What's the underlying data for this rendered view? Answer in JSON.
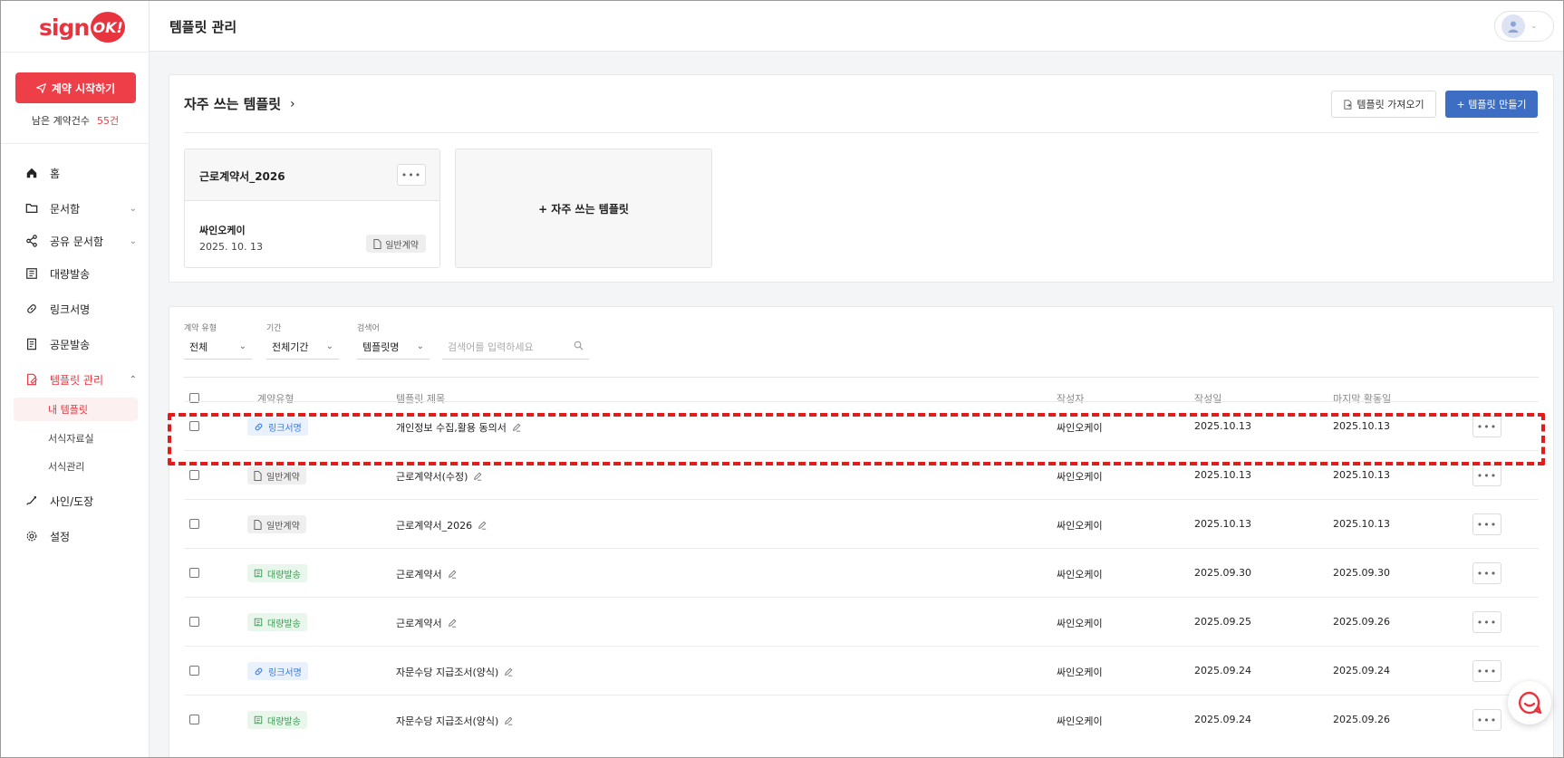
{
  "app": {
    "logo_text": "sign",
    "logo_badge": "OK!"
  },
  "sidebar": {
    "start_button": "계약 시작하기",
    "remaining_label": "남은 계약건수",
    "remaining_count": "55건",
    "items": [
      {
        "label": "홈",
        "icon": "home-icon"
      },
      {
        "label": "문서함",
        "icon": "folder-icon"
      },
      {
        "label": "공유 문서함",
        "icon": "share-icon"
      },
      {
        "label": "대량발송",
        "icon": "bulk-send-icon"
      },
      {
        "label": "링크서명",
        "icon": "link-icon"
      },
      {
        "label": "공문발송",
        "icon": "official-doc-icon"
      },
      {
        "label": "템플릿 관리",
        "icon": "template-icon"
      },
      {
        "label": "사인/도장",
        "icon": "signature-icon"
      },
      {
        "label": "설정",
        "icon": "gear-icon"
      }
    ],
    "sub_items": [
      "내 템플릿",
      "서식자료실",
      "서식관리"
    ]
  },
  "header": {
    "title": "템플릿 관리"
  },
  "favorites": {
    "title": "자주 쓰는 템플릿",
    "import_button": "템플릿 가져오기",
    "create_button": "+ 템플릿 만들기",
    "card": {
      "title": "근로계약서_2026",
      "author": "싸인오케이",
      "date": "2025. 10. 13",
      "type": "일반계약"
    },
    "add_label": "+ 자주 쓰는 템플릿"
  },
  "filters": {
    "type_label": "계약 유형",
    "type_value": "전체",
    "period_label": "기간",
    "period_value": "전체기간",
    "search_label": "검색어",
    "search_field_value": "템플릿명",
    "search_placeholder": "검색어를 입력하세요"
  },
  "table": {
    "headers": {
      "type": "계약유형",
      "title": "템플릿 제목",
      "author": "작성자",
      "created": "작성일",
      "last_active": "마지막 활동일"
    },
    "rows": [
      {
        "type": "링크서명",
        "kind": "link",
        "title": "개인정보 수집,활용 동의서",
        "author": "싸인오케이",
        "created": "2025.10.13",
        "last_active": "2025.10.13"
      },
      {
        "type": "일반계약",
        "kind": "normal",
        "title": "근로계약서(수정)",
        "author": "싸인오케이",
        "created": "2025.10.13",
        "last_active": "2025.10.13"
      },
      {
        "type": "일반계약",
        "kind": "normal",
        "title": "근로계약서_2026",
        "author": "싸인오케이",
        "created": "2025.10.13",
        "last_active": "2025.10.13"
      },
      {
        "type": "대량발송",
        "kind": "bulk",
        "title": "근로계약서",
        "author": "싸인오케이",
        "created": "2025.09.30",
        "last_active": "2025.09.30"
      },
      {
        "type": "대량발송",
        "kind": "bulk",
        "title": "근로계약서",
        "author": "싸인오케이",
        "created": "2025.09.25",
        "last_active": "2025.09.26"
      },
      {
        "type": "링크서명",
        "kind": "link",
        "title": "자문수당 지급조서(양식)",
        "author": "싸인오케이",
        "created": "2025.09.24",
        "last_active": "2025.09.24"
      },
      {
        "type": "대량발송",
        "kind": "bulk",
        "title": "자문수당 지급조서(양식)",
        "author": "싸인오케이",
        "created": "2025.09.24",
        "last_active": "2025.09.26"
      }
    ]
  },
  "colors": {
    "brand": "#e8343f",
    "primary": "#3d6ec4",
    "highlight": "#e21b1b"
  }
}
